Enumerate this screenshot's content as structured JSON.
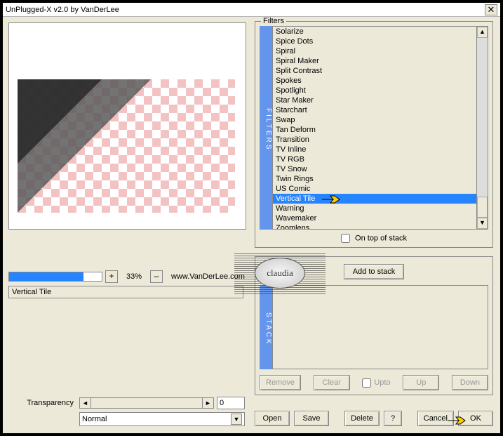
{
  "window": {
    "title": "UnPlugged-X v2.0 by VanDerLee"
  },
  "preview": {
    "zoom_value": "33%",
    "plus": "+",
    "minus": "–",
    "website": "www.VanDerLee.com",
    "selected_filter": "Vertical Tile"
  },
  "transparency": {
    "label": "Transparency",
    "value": "0"
  },
  "blend": {
    "value": "Normal"
  },
  "filters": {
    "legend": "Filters",
    "tab": "FILTERS",
    "items": [
      "Solarize",
      "Spice Dots",
      "Spiral",
      "Spiral Maker",
      "Split Contrast",
      "Spokes",
      "Spotlight",
      "Star Maker",
      "Starchart",
      "Swap",
      "Tan Deform",
      "Transition",
      "TV Inline",
      "TV RGB",
      "TV Snow",
      "Twin Rings",
      "US Comic",
      "Vertical Tile",
      "Warning",
      "Wavemaker",
      "Zoomlens"
    ],
    "selected_index": 17,
    "on_top_label": "On top of stack"
  },
  "stack": {
    "tab": "STACK",
    "add_label": "Add to stack",
    "remove": "Remove",
    "clear": "Clear",
    "upto": "Upto",
    "up": "Up",
    "down": "Down"
  },
  "buttons": {
    "open": "Open",
    "save": "Save",
    "delete": "Delete",
    "help": "?",
    "cancel": "Cancel",
    "ok": "OK"
  },
  "watermark": "claudia"
}
